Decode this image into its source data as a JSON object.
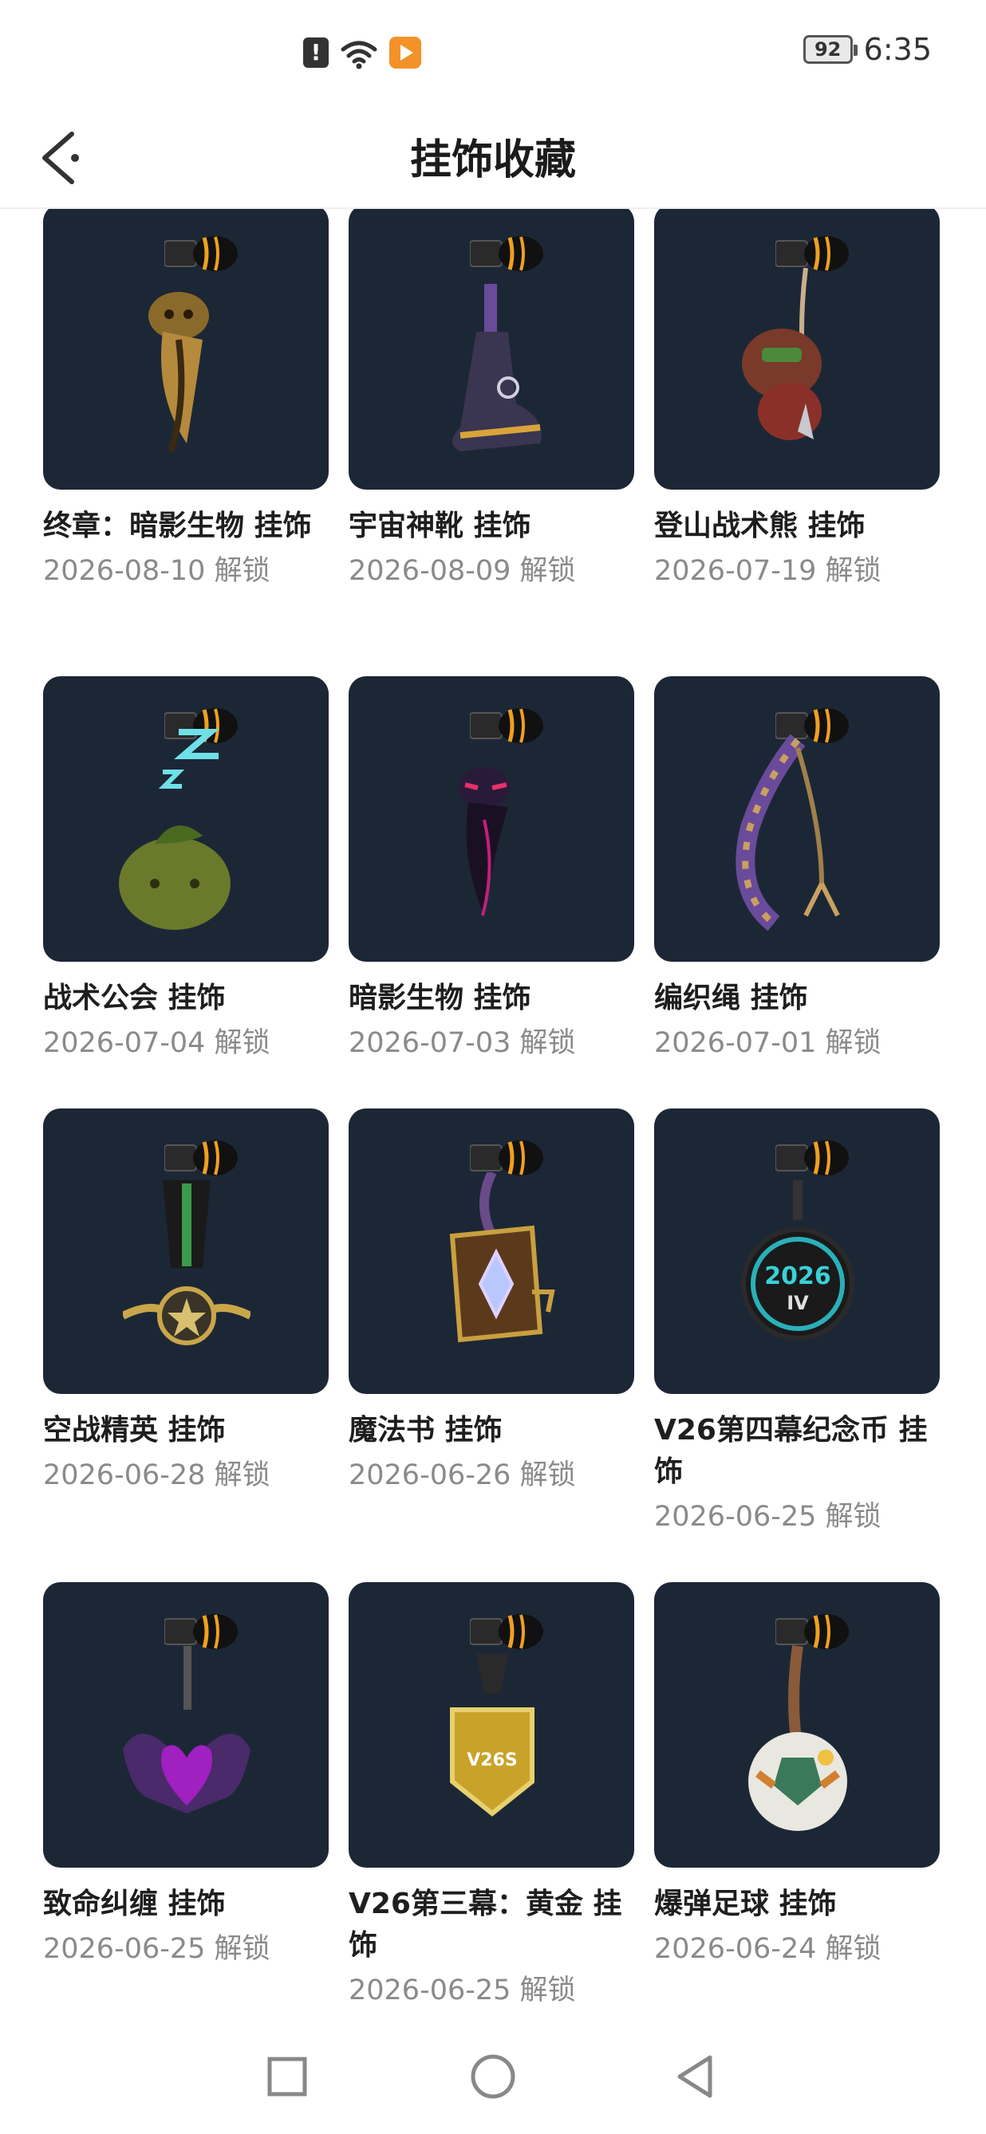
{
  "status_bar": {
    "time": "6:35",
    "battery": "92",
    "alert_glyph": "!",
    "icons": [
      "alert-icon",
      "wifi-icon",
      "video-app-icon",
      "battery-icon"
    ]
  },
  "header": {
    "title": "挂饰收藏",
    "back_icon": "chevron-left-icon"
  },
  "items": [
    {
      "name": "终章：暗影生物 挂饰",
      "date": "2026-08-10 解锁"
    },
    {
      "name": "宇宙神靴 挂饰",
      "date": "2026-08-09 解锁"
    },
    {
      "name": "登山战术熊 挂饰",
      "date": "2026-07-19 解锁"
    },
    {
      "name": "战术公会 挂饰",
      "date": "2026-07-04 解锁"
    },
    {
      "name": "暗影生物 挂饰",
      "date": "2026-07-03 解锁"
    },
    {
      "name": "编织绳 挂饰",
      "date": "2026-07-01 解锁"
    },
    {
      "name": "空战精英 挂饰",
      "date": "2026-06-28 解锁"
    },
    {
      "name": "魔法书 挂饰",
      "date": "2026-06-26 解锁"
    },
    {
      "name": "V26第四幕纪念币 挂饰",
      "date": "2026-06-25 解锁"
    },
    {
      "name": "致命纠缠 挂饰",
      "date": "2026-06-25 解锁"
    },
    {
      "name": "V26第三幕：黄金 挂饰",
      "date": "2026-06-25 解锁"
    },
    {
      "name": "爆弹足球 挂饰",
      "date": "2026-06-24 解锁"
    }
  ],
  "coin_text": {
    "year": "2026",
    "act": "IV"
  },
  "gold_badge_text": "V26S",
  "nav_bar": {
    "buttons": [
      "recent-apps-icon",
      "home-icon",
      "back-icon"
    ]
  },
  "colors": {
    "thumb_bg": "#1c2736",
    "accent_orange": "#f39228",
    "date_gray": "#8a8a8a"
  }
}
